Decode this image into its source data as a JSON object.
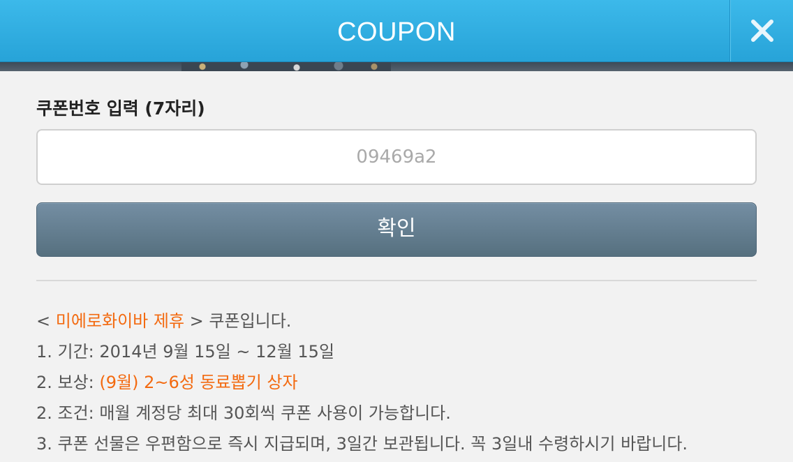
{
  "header": {
    "title": "COUPON",
    "close_icon": "close-icon"
  },
  "form": {
    "label": "쿠폰번호 입력 (7자리)",
    "input_value": "09469a2",
    "confirm_label": "확인"
  },
  "info": {
    "line1": {
      "open": "< ",
      "partner": "미에로화이바 제휴",
      "close": " >",
      "rest": " 쿠폰입니다."
    },
    "line2": "1. 기간: 2014년 9월 15일 ~ 12월 15일",
    "line3": {
      "prefix": "2. 보상: ",
      "reward": "(9월) 2~6성 동료뽑기 상자"
    },
    "line4": "2. 조건: 매월 계정당 최대 30회씩 쿠폰 사용이 가능합니다.",
    "line5": "3. 쿠폰 선물은 우편함으로 즉시 지급되며, 3일간 보관됩니다. 꼭 3일내 수령하시기 바랍니다."
  },
  "colors": {
    "header_blue": "#2fb0e4",
    "accent_orange": "#f36a10",
    "button_slate": "#64808f"
  }
}
